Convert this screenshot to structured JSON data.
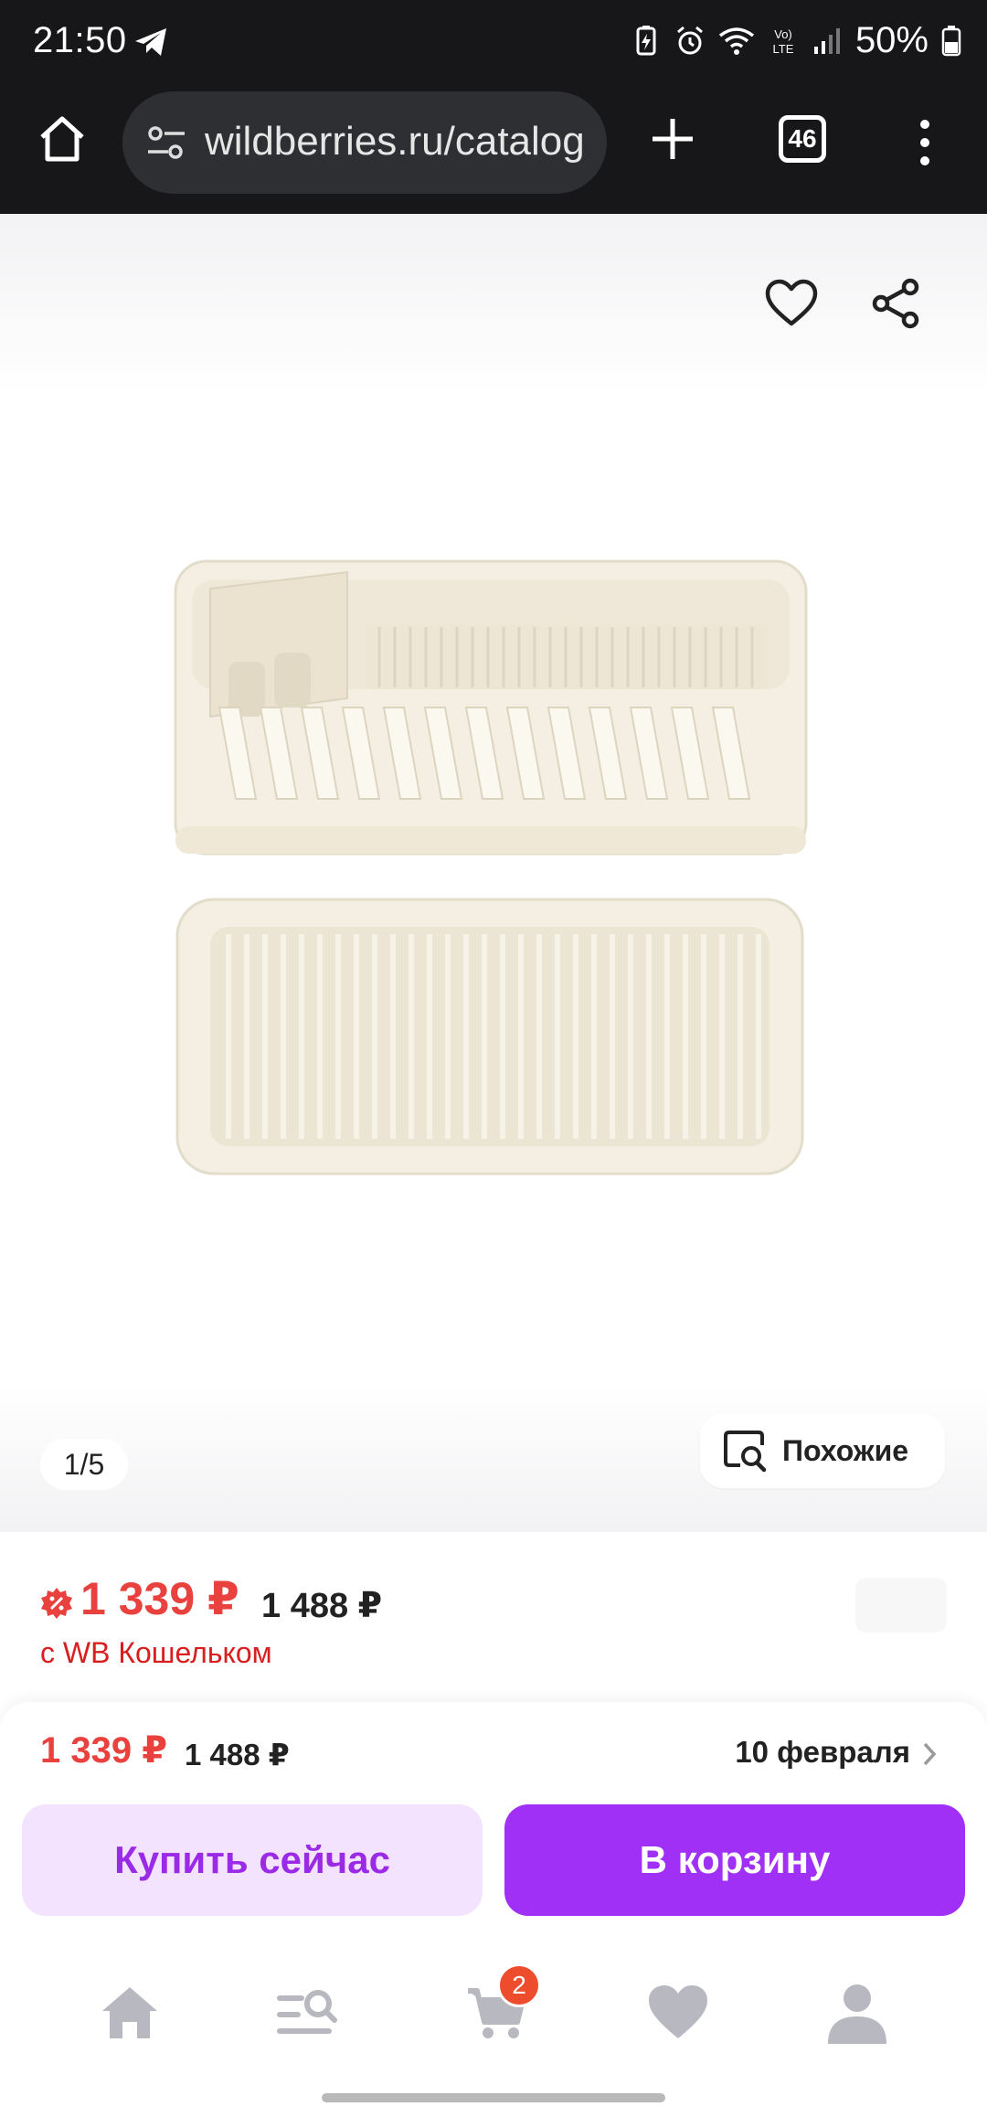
{
  "status_bar": {
    "time": "21:50",
    "battery": "50%",
    "network": "LTE"
  },
  "browser": {
    "url": "wildberries.ru/catalog",
    "tab_count": "46"
  },
  "gallery": {
    "counter": "1/5",
    "similar_label": "Похожие"
  },
  "price": {
    "current": "1 339 ₽",
    "old": "1 488 ₽",
    "wallet_note": "с WB Кошельком"
  },
  "purchase_panel": {
    "price": "1 339 ₽",
    "old_price": "1 488 ₽",
    "delivery_date": "10 февраля",
    "buy_now_label": "Купить сейчас",
    "add_to_cart_label": "В корзину"
  },
  "bottom_nav": {
    "cart_badge": "2"
  },
  "colors": {
    "accent": "#a030f5",
    "price_red": "#e8413e",
    "dark_bar": "#17171a"
  }
}
